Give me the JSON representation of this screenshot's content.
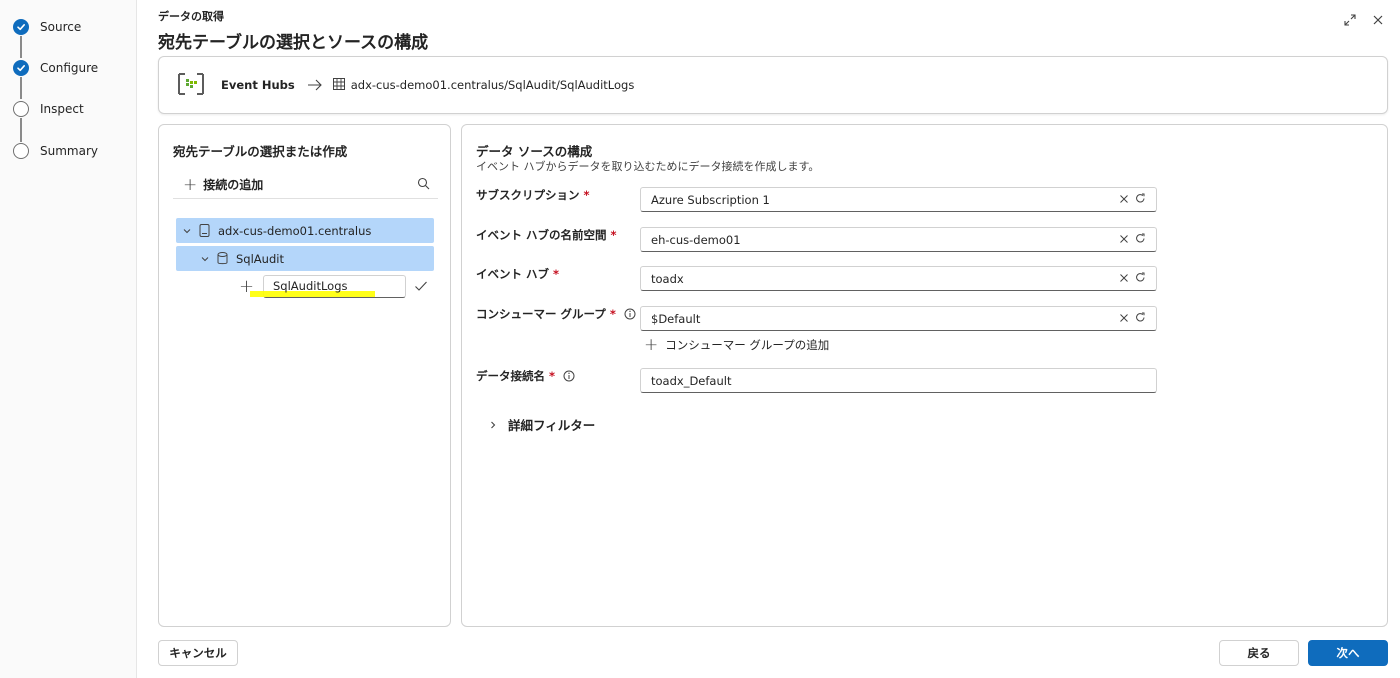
{
  "stepper": {
    "steps": [
      {
        "label": "Source",
        "state": "done"
      },
      {
        "label": "Configure",
        "state": "done"
      },
      {
        "label": "Inspect",
        "state": "todo"
      },
      {
        "label": "Summary",
        "state": "todo"
      }
    ]
  },
  "header": {
    "subtitle": "データの取得",
    "title": "宛先テーブルの選択とソースの構成",
    "expand_icon": "expand-icon",
    "close_icon": "close-icon"
  },
  "source_strip": {
    "source_name": "Event Hubs",
    "destination_path": "adx-cus-demo01.centralus/SqlAudit/SqlAuditLogs"
  },
  "left_panel": {
    "title": "宛先テーブルの選択または作成",
    "add_connection_label": "接続の追加",
    "tree": {
      "cluster": "adx-cus-demo01.centralus",
      "database": "SqlAudit",
      "new_table_value": "SqlAuditLogs"
    }
  },
  "right_panel": {
    "title": "データ ソースの構成",
    "description": "イベント ハブからデータを取り込むためにデータ接続を作成します。",
    "fields": {
      "subscription": {
        "label": "サブスクリプション",
        "value": "Azure Subscription 1"
      },
      "namespace": {
        "label": "イベント ハブの名前空間",
        "value": "eh-cus-demo01"
      },
      "event_hub": {
        "label": "イベント ハブ",
        "value": "toadx"
      },
      "consumer_group": {
        "label": "コンシューマー グループ",
        "value": "$Default"
      },
      "connection_name": {
        "label": "データ接続名",
        "value": "toadx_Default"
      }
    },
    "required_mark": "*",
    "add_consumer_group_label": "コンシューマー グループの追加",
    "advanced_filter_label": "詳細フィルター"
  },
  "footer": {
    "cancel_label": "キャンセル",
    "back_label": "戻る",
    "next_label": "次へ"
  },
  "colors": {
    "accent": "#0f6cbd",
    "selected_row": "#b4d6fa",
    "required": "#c50f1f",
    "highlight": "#ffff00"
  }
}
